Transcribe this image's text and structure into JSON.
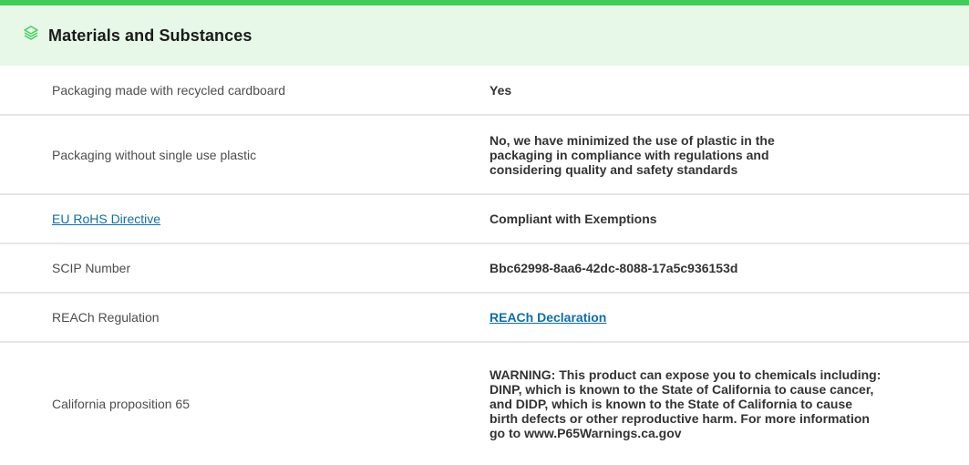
{
  "section": {
    "title": "Materials and Substances",
    "icon": "layers-icon",
    "accent_color": "#3dcd58",
    "header_bg": "#e7f8e8",
    "link_color": "#0d6eaa"
  },
  "rows": [
    {
      "label": "Packaging made with recycled cardboard",
      "value": "Yes"
    },
    {
      "label": "Packaging without single use plastic",
      "value": "No, we have minimized the use of plastic in the packaging in compliance with regulations and considering quality and safety standards"
    },
    {
      "label": "EU RoHS Directive",
      "value": "Compliant with Exemptions"
    },
    {
      "label": "SCIP Number",
      "value": "Bbc62998-8aa6-42dc-8088-17a5c936153d"
    },
    {
      "label": "REACh Regulation",
      "value": "REACh Declaration"
    },
    {
      "label": "California proposition 65",
      "value": "WARNING: This product can expose you to chemicals including: DINP, which is known to the State of California to cause cancer, and DIDP, which is known to the State of California to cause birth defects or other reproductive harm. For more information go to www.P65Warnings.ca.gov"
    }
  ]
}
